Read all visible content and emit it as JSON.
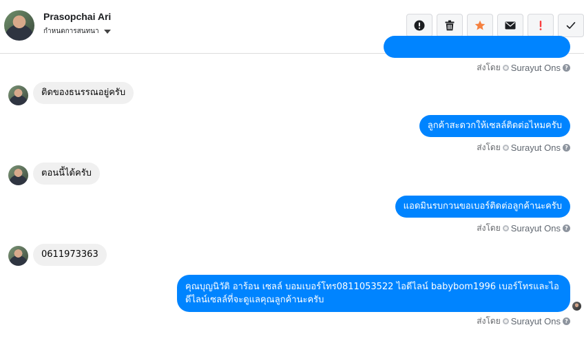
{
  "header": {
    "contact_name": "Prasopchai Ari",
    "status_label": "กำหนดการสนทนา",
    "actions": [
      {
        "name": "mark-spam-icon"
      },
      {
        "name": "trash-icon"
      },
      {
        "name": "star-icon",
        "color": "#f5803e"
      },
      {
        "name": "mail-icon"
      },
      {
        "name": "priority-icon",
        "color": "#fa3e3e"
      },
      {
        "name": "check-icon"
      }
    ]
  },
  "sent_by_label": "ส่งโดย",
  "agent_name": "Surayut Ons",
  "help_glyph": "?",
  "messages": [
    {
      "direction": "in",
      "text": "ติดของธนรรณอยู่ครับ"
    },
    {
      "direction": "out",
      "text": "ลูกค้าสะดวกให้เซลล์ติดต่อไหมครับ"
    },
    {
      "direction": "in",
      "text": "ตอนนี้ได้ครับ"
    },
    {
      "direction": "out",
      "text": "แอดมินรบกวนขอเบอร์ติดต่อลูกค้านะครับ"
    },
    {
      "direction": "in",
      "text": "0611973363"
    },
    {
      "direction": "out",
      "text": "คุณบุญนิวัติ อาร้อน เซลล์ บอมเบอร์โทร0811053522 ไอดีไลน์ babybom1996  เบอร์โทรและไอดีไลน์เซลล์ที่จะดูแลคุณลูกค้านะครับ"
    }
  ],
  "colors": {
    "outgoing_bubble": "#0084ff",
    "incoming_bubble": "#f0f0f0"
  }
}
